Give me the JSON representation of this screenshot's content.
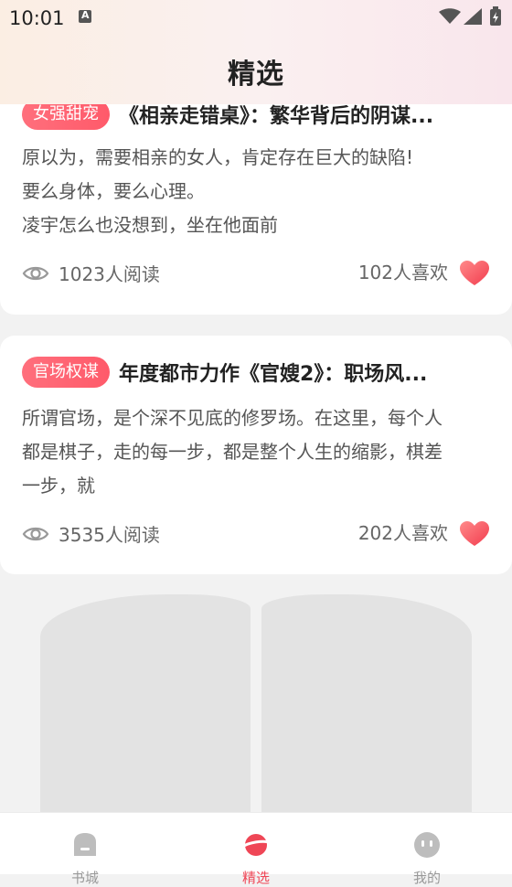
{
  "status_bar": {
    "time": "10:01"
  },
  "header": {
    "title": "精选"
  },
  "articles": [
    {
      "tag": "女强甜宠",
      "title": "《相亲走错桌》：繁华背后的阴谋...",
      "excerpt": [
        "原以为，需要相亲的女人，肯定存在巨大的缺陷!",
        "要么身体，要么心理。",
        "凌宇怎么也没想到，坐在他面前"
      ],
      "reads": "1023人阅读",
      "likes": "102人喜欢"
    },
    {
      "tag": "官场权谋",
      "title": "年度都市力作《官嫂2》：职场风...",
      "excerpt": [
        "所谓官场，是个深不见底的修罗场。在这里，每个人",
        "都是棋子，走的每一步，都是整个人生的缩影，棋差",
        "一步，就"
      ],
      "reads": "3535人阅读",
      "likes": "202人喜欢"
    }
  ],
  "tabs": [
    {
      "label": "书城",
      "icon": "bookstore-icon",
      "active": false
    },
    {
      "label": "精选",
      "icon": "planet-icon",
      "active": true
    },
    {
      "label": "我的",
      "icon": "profile-icon",
      "active": false
    }
  ],
  "colors": {
    "accent": "#ef4656",
    "tag": "#ff5f6d"
  }
}
